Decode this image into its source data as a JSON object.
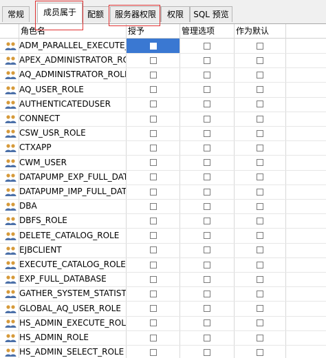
{
  "tabs": [
    {
      "label": "常规",
      "active": false
    },
    {
      "label": "成员属于",
      "active": true,
      "highlighted": true
    },
    {
      "label": "配额",
      "active": false
    },
    {
      "label": "服务器权限",
      "active": false,
      "highlighted": true
    },
    {
      "label": "权限",
      "active": false
    },
    {
      "label": "SQL 预览",
      "active": false
    }
  ],
  "columns": {
    "role_name": "角色名",
    "granted": "授予",
    "admin_option": "管理选项",
    "as_default": "作为默认"
  },
  "colors": {
    "selection": "#3a78d2",
    "highlight_box": "#e03030",
    "icon_person": "#d69a3a"
  },
  "rows": [
    {
      "name": "ADM_PARALLEL_EXECUTE_TASK",
      "granted": false,
      "admin_option": false,
      "as_default": false,
      "selected": true
    },
    {
      "name": "APEX_ADMINISTRATOR_ROLE",
      "granted": false,
      "admin_option": false,
      "as_default": false
    },
    {
      "name": "AQ_ADMINISTRATOR_ROLE",
      "granted": false,
      "admin_option": false,
      "as_default": false
    },
    {
      "name": "AQ_USER_ROLE",
      "granted": false,
      "admin_option": false,
      "as_default": false
    },
    {
      "name": "AUTHENTICATEDUSER",
      "granted": false,
      "admin_option": false,
      "as_default": false
    },
    {
      "name": "CONNECT",
      "granted": false,
      "admin_option": false,
      "as_default": false
    },
    {
      "name": "CSW_USR_ROLE",
      "granted": false,
      "admin_option": false,
      "as_default": false
    },
    {
      "name": "CTXAPP",
      "granted": false,
      "admin_option": false,
      "as_default": false
    },
    {
      "name": "CWM_USER",
      "granted": false,
      "admin_option": false,
      "as_default": false
    },
    {
      "name": "DATAPUMP_EXP_FULL_DATABASE",
      "granted": false,
      "admin_option": false,
      "as_default": false
    },
    {
      "name": "DATAPUMP_IMP_FULL_DATABASE",
      "granted": false,
      "admin_option": false,
      "as_default": false
    },
    {
      "name": "DBA",
      "granted": false,
      "admin_option": false,
      "as_default": false
    },
    {
      "name": "DBFS_ROLE",
      "granted": false,
      "admin_option": false,
      "as_default": false
    },
    {
      "name": "DELETE_CATALOG_ROLE",
      "granted": false,
      "admin_option": false,
      "as_default": false
    },
    {
      "name": "EJBCLIENT",
      "granted": false,
      "admin_option": false,
      "as_default": false
    },
    {
      "name": "EXECUTE_CATALOG_ROLE",
      "granted": false,
      "admin_option": false,
      "as_default": false
    },
    {
      "name": "EXP_FULL_DATABASE",
      "granted": false,
      "admin_option": false,
      "as_default": false
    },
    {
      "name": "GATHER_SYSTEM_STATISTICS",
      "granted": false,
      "admin_option": false,
      "as_default": false
    },
    {
      "name": "GLOBAL_AQ_USER_ROLE",
      "granted": false,
      "admin_option": false,
      "as_default": false
    },
    {
      "name": "HS_ADMIN_EXECUTE_ROLE",
      "granted": false,
      "admin_option": false,
      "as_default": false
    },
    {
      "name": "HS_ADMIN_ROLE",
      "granted": false,
      "admin_option": false,
      "as_default": false
    },
    {
      "name": "HS_ADMIN_SELECT_ROLE",
      "granted": false,
      "admin_option": false,
      "as_default": false
    }
  ]
}
